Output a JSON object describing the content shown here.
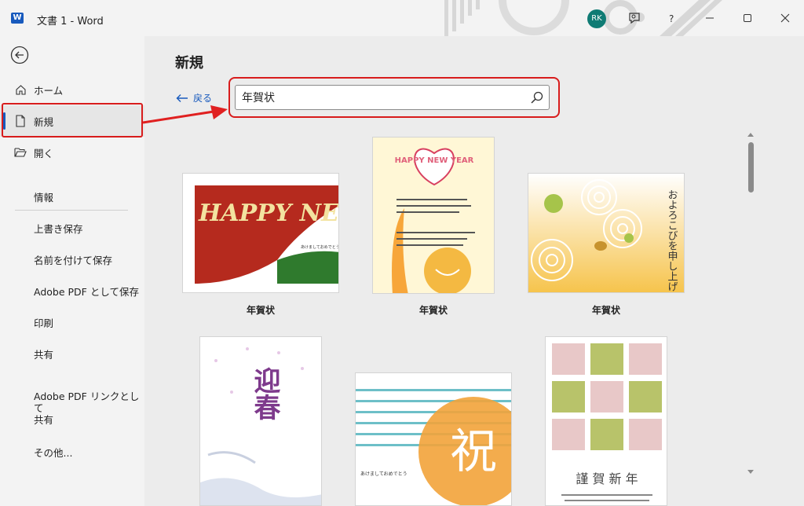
{
  "window": {
    "title": "文書 1  -  Word",
    "app_icon": "word-icon",
    "user_initials": "RK",
    "colors": {
      "accent": "#185abd",
      "highlight": "#d81c1c",
      "avatar": "#0f7b74"
    }
  },
  "sidebar": {
    "items": [
      {
        "label": "ホーム",
        "icon": "home-icon"
      },
      {
        "label": "新規",
        "icon": "new-document-icon",
        "selected": true
      },
      {
        "label": "開く",
        "icon": "folder-open-icon"
      },
      {
        "label": "情報"
      },
      {
        "label": "上書き保存"
      },
      {
        "label": "名前を付けて保存"
      },
      {
        "label": "Adobe PDF として保存"
      },
      {
        "label": "印刷"
      },
      {
        "label": "共有"
      },
      {
        "label_line1": "Adobe PDF リンクとして",
        "label_line2": "共有"
      },
      {
        "label": "その他..."
      }
    ]
  },
  "main": {
    "title": "新規",
    "back_label": "戻る",
    "search": {
      "value": "年賀状"
    },
    "templates": [
      {
        "label": "年賀状",
        "text": "HAPPY NEW YEAR"
      },
      {
        "label": "年賀状",
        "text": "HAPPY NEW YEAR"
      },
      {
        "label": "年賀状",
        "text": "およろこびを申し上げます"
      },
      {
        "label": "",
        "text": "迎春"
      },
      {
        "label": "",
        "text": "祝"
      },
      {
        "label": "",
        "text": "謹 賀 新 年"
      }
    ]
  }
}
